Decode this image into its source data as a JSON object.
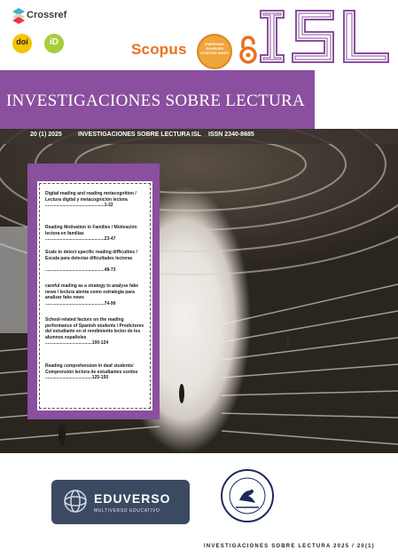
{
  "header": {
    "crossref_label": "Crossref",
    "doi_label": "doi",
    "orcid_label": "iD",
    "scopus_label": "Scopus",
    "esci_label": "EMERGING SOURCES CITATION INDEX",
    "isl_logo_text": "ISL"
  },
  "band": {
    "title": "INVESTIGACIONES SOBRE LECTURA",
    "color": "#8a4f9e"
  },
  "infobar": {
    "issue": "20 (1) 2025",
    "journal": "INVESTIGACIONES SOBRE LECTURA",
    "abbr": "ISL",
    "issn": "ISSN  2340-8685"
  },
  "toc": [
    {
      "title": "Digital reading and reading metacognition / Lectura digital y metacognición lectora",
      "pages": "................................................1-22"
    },
    {
      "title": "Reading Motivation in Families / Motivación lectora en familias",
      "pages": "................................................23-47"
    },
    {
      "title": "Scale to detect specific reading difficulties / Escala para detectar dificultades lectoras",
      "pages": "................................................48-73"
    },
    {
      "title": "careful reading as a strategy to analyse fake news / lectura atenta como estrategia para analizar fake news",
      "pages": "................................................74-99"
    },
    {
      "title": "School-related factors on the reading performance of Spanish students / Predictores del estudiante en el rendimiento lector de los alumnos españoles",
      "pages": "......................................100-124"
    },
    {
      "title": "Reading comprehension in deaf students/ Comprensión lectora de estudiantes sordos",
      "pages": "......................................125-150"
    }
  ],
  "logos": {
    "eduverso_name": "EDUVERSO",
    "eduverso_sub": "MULTIVERSO EDUCATIVO"
  },
  "footer": "INVESTIGACIONES SOBRE LECTURA 2025 / 20(1)"
}
